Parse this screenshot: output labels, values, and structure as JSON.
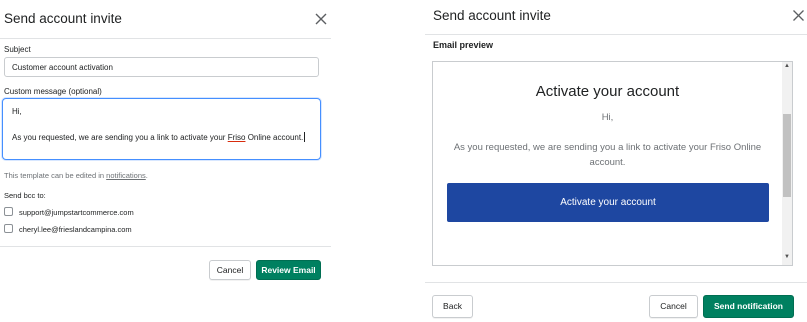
{
  "left_dialog": {
    "title": "Send account invite",
    "subject_label": "Subject",
    "subject_value": "Customer account activation",
    "message_label": "Custom message (optional)",
    "message_line1": "Hi,",
    "message_line2_pre": "As you requested, we are sending you a link to activate your ",
    "message_line2_word": "Friso",
    "message_line2_post": " Online account.",
    "hint_pre": "This template can be edited in ",
    "hint_link": "notifications",
    "hint_post": ".",
    "bcc_label": "Send bcc to:",
    "bcc_options": [
      "support@jumpstartcommerce.com",
      "cheryl.lee@frieslandcampina.com"
    ],
    "cancel_label": "Cancel",
    "review_label": "Review Email"
  },
  "right_dialog": {
    "title": "Send account invite",
    "preview_label": "Email preview",
    "preview_heading": "Activate your account",
    "preview_greeting": "Hi,",
    "preview_body": "As you requested, we are sending you a link to activate your Friso Online account.",
    "preview_button": "Activate your account",
    "back_label": "Back",
    "cancel_label": "Cancel",
    "send_label": "Send notification"
  },
  "colors": {
    "primary_green": "#008060",
    "focus_blue": "#458fff",
    "email_button_blue": "#1e47a1"
  },
  "icons": [
    "close-icon",
    "scroll-up-icon",
    "scroll-down-icon",
    "brand-logo"
  ]
}
